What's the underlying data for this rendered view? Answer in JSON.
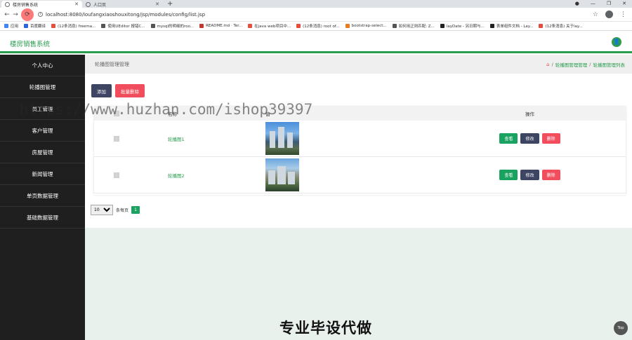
{
  "browser": {
    "tabs": [
      {
        "label": "楼房销售系统",
        "active": true
      },
      {
        "label": "人口页",
        "active": false
      }
    ],
    "new_tab": "+",
    "window_controls": [
      "●",
      "—",
      "❐",
      "✕"
    ],
    "url": "localhost:8080/loufangxiaoshouxitong/jsp/modules/config/list.jsp",
    "bookmarks": [
      {
        "label": "应用",
        "color": "#4285f4"
      },
      {
        "label": "百度翻译",
        "color": "#2a66d9"
      },
      {
        "label": "(12条消息) freema...",
        "color": "#e74c3c"
      },
      {
        "label": "使用UEditor 报错C...",
        "color": "#555555"
      },
      {
        "label": "mysql的明细的roo...",
        "color": "#555555"
      },
      {
        "label": "README.md · Ter...",
        "color": "#c0392b"
      },
      {
        "label": "在java web项目中...",
        "color": "#e74c3c"
      },
      {
        "label": "(12条消息) root of...",
        "color": "#e74c3c"
      },
      {
        "label": "bootstrap-select...",
        "color": "#e67e22"
      },
      {
        "label": "如何用正则匹配: Z...",
        "color": "#555555"
      },
      {
        "label": "layDate - 另日期与...",
        "color": "#222222"
      },
      {
        "label": "表单组件文档 - Lay...",
        "color": "#222222"
      },
      {
        "label": "(12条消息) 关于lay...",
        "color": "#e74c3c"
      }
    ]
  },
  "app": {
    "title": "楼房销售系统",
    "accent": "#2a9d4f"
  },
  "sidebar": {
    "items": [
      {
        "label": "个人中心"
      },
      {
        "label": "轮播图管理"
      },
      {
        "label": "员工管理"
      },
      {
        "label": "客户管理"
      },
      {
        "label": "房屋管理"
      },
      {
        "label": "新闻管理"
      },
      {
        "label": "单页数据管理"
      },
      {
        "label": "基础数据管理"
      }
    ]
  },
  "main": {
    "page_title": "轮播图管理管理",
    "breadcrumb": {
      "home_icon": "⌂",
      "sep": "/",
      "items": [
        "轮播图管理管理",
        "轮播图管理列表"
      ]
    },
    "toolbar": {
      "add_label": "添加",
      "batch_delete_label": "批量删除"
    },
    "table": {
      "headers": {
        "name": "名称",
        "image": "值",
        "ops": "操作"
      },
      "rows": [
        {
          "name": "轮播图1",
          "view": "查看",
          "edit": "修改",
          "delete": "删除"
        },
        {
          "name": "轮播图2",
          "view": "查看",
          "edit": "修改",
          "delete": "删除"
        }
      ]
    },
    "pager": {
      "page_size": "10",
      "page_size_options": [
        "10"
      ],
      "per_page_label": "条每页",
      "current_page": "1"
    }
  },
  "overlay": {
    "watermark": "https://www.huzhan.com/ishop39397",
    "banner": "专业毕设代做",
    "top_button": "Top"
  }
}
